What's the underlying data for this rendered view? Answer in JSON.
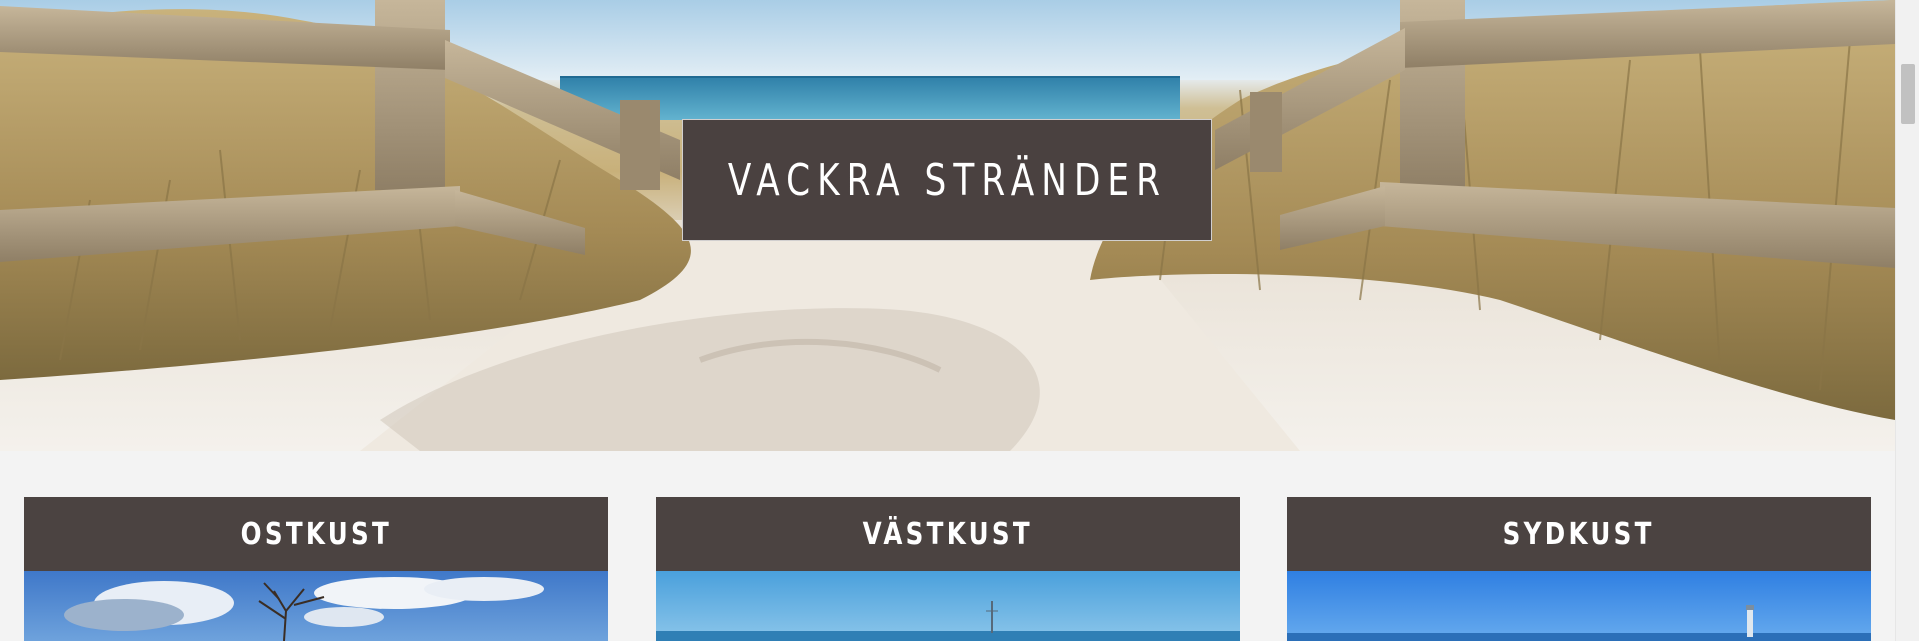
{
  "hero": {
    "title": "VACKRA STRÄNDER",
    "image": "beach-path-dunes-fence"
  },
  "cards": [
    {
      "title": "OSTKUST",
      "image": "east-coast-sky-trees"
    },
    {
      "title": "VÄSTKUST",
      "image": "west-coast-sea-sailboat"
    },
    {
      "title": "SYDKUST",
      "image": "south-coast-sea-lighthouse"
    }
  ],
  "colors": {
    "title_box_bg": "#4a4140",
    "card_header_bg": "#4b4341",
    "page_bg": "#f3f3f3"
  }
}
